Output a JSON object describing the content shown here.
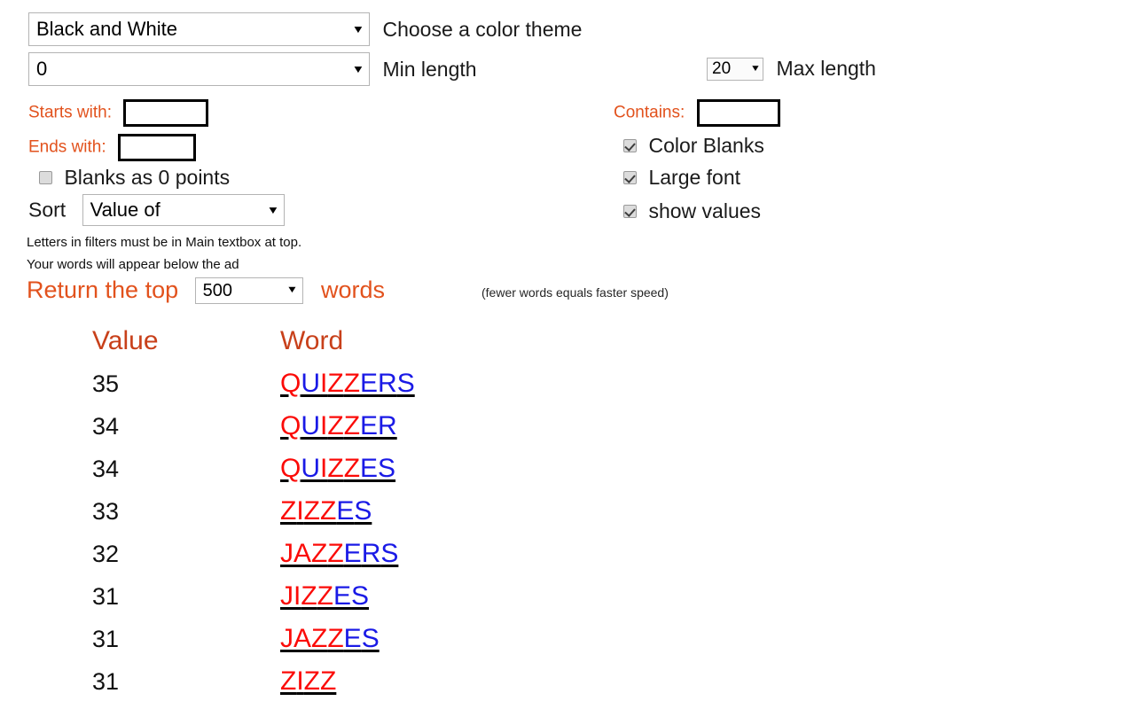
{
  "colors": {
    "letter_red": "#fb0b08",
    "letter_blue": "#1a1ae6",
    "label_orange": "#e2521d",
    "header_orange": "#c8401a"
  },
  "controls": {
    "theme": {
      "value": "Black and White",
      "label": "Choose a color theme"
    },
    "min_length": {
      "value": "0",
      "label": "Min length"
    },
    "max_length": {
      "value": "20",
      "label": "Max length"
    },
    "starts_with": {
      "label": "Starts with:",
      "value": "",
      "placeholder": ""
    },
    "ends_with": {
      "label": "Ends with:",
      "value": "",
      "placeholder": ""
    },
    "contains": {
      "label": "Contains:",
      "value": "",
      "placeholder": ""
    },
    "blanks_as_zero": {
      "label": "Blanks as 0 points",
      "checked": false
    },
    "color_blanks": {
      "label": "Color Blanks",
      "checked": true
    },
    "large_font": {
      "label": "Large font",
      "checked": true
    },
    "show_values": {
      "label": "show values",
      "checked": true
    },
    "sort": {
      "label": "Sort",
      "value": "Value of"
    }
  },
  "notes": {
    "line1": "Letters in filters must be in Main textbox at top.",
    "line2": "Your words will appear below the ad"
  },
  "return_top": {
    "prefix": "Return the top",
    "value": "500",
    "suffix": "words",
    "hint": "(fewer words equals faster speed)"
  },
  "results": {
    "headers": {
      "value": "Value",
      "word": "Word"
    },
    "rows": [
      {
        "value": "35",
        "word": "QUIZZERS",
        "letter_colors": [
          "r",
          "b",
          "r",
          "r",
          "r",
          "b",
          "b",
          "b"
        ]
      },
      {
        "value": "34",
        "word": "QUIZZER",
        "letter_colors": [
          "r",
          "b",
          "r",
          "r",
          "r",
          "b",
          "b"
        ]
      },
      {
        "value": "34",
        "word": "QUIZZES",
        "letter_colors": [
          "r",
          "b",
          "r",
          "r",
          "r",
          "b",
          "b"
        ]
      },
      {
        "value": "33",
        "word": "ZIZZES",
        "letter_colors": [
          "r",
          "r",
          "r",
          "r",
          "b",
          "b"
        ]
      },
      {
        "value": "32",
        "word": "JAZZERS",
        "letter_colors": [
          "r",
          "r",
          "r",
          "r",
          "b",
          "b",
          "b"
        ]
      },
      {
        "value": "31",
        "word": "JIZZES",
        "letter_colors": [
          "r",
          "r",
          "r",
          "r",
          "b",
          "b"
        ]
      },
      {
        "value": "31",
        "word": "JAZZES",
        "letter_colors": [
          "r",
          "r",
          "r",
          "r",
          "b",
          "b"
        ]
      },
      {
        "value": "31",
        "word": "ZIZZ",
        "letter_colors": [
          "r",
          "r",
          "r",
          "r"
        ]
      }
    ]
  }
}
